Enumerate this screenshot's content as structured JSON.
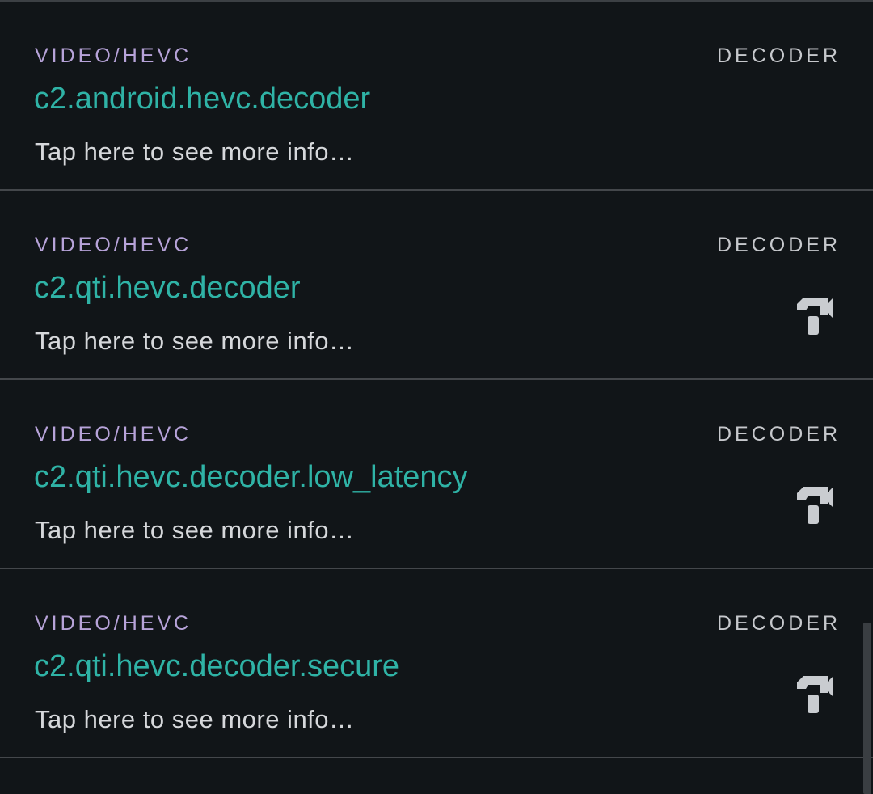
{
  "codecs": [
    {
      "mime": "VIDEO/HEVC",
      "kind": "DECODER",
      "name": "c2.android.hevc.decoder",
      "hint": "Tap here to see more info…",
      "hardware_icon": null
    },
    {
      "mime": "VIDEO/HEVC",
      "kind": "DECODER",
      "name": "c2.qti.hevc.decoder",
      "hint": "Tap here to see more info…",
      "hardware_icon": "hammer-icon"
    },
    {
      "mime": "VIDEO/HEVC",
      "kind": "DECODER",
      "name": "c2.qti.hevc.decoder.low_latency",
      "hint": "Tap here to see more info…",
      "hardware_icon": "hammer-icon"
    },
    {
      "mime": "VIDEO/HEVC",
      "kind": "DECODER",
      "name": "c2.qti.hevc.decoder.secure",
      "hint": "Tap here to see more info…",
      "hardware_icon": "hammer-icon"
    }
  ],
  "colors": {
    "background": "#111518",
    "mime": "#b7a3d9",
    "name": "#2fb3a6",
    "hint": "#d6d8db",
    "icon": "#c9ccd0",
    "divider": "#44474b"
  }
}
